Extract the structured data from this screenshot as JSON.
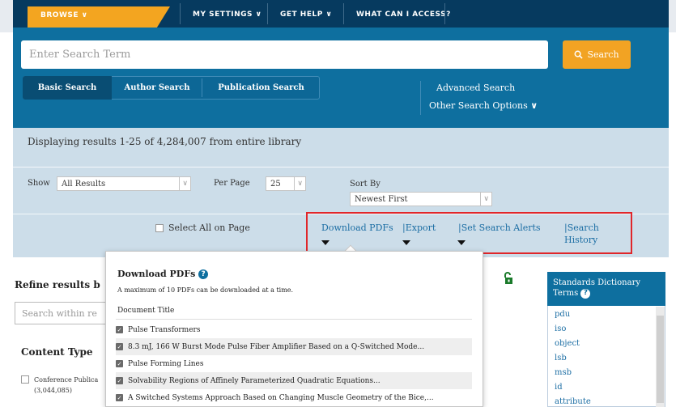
{
  "nav": {
    "browse": "BROWSE",
    "my_settings": "MY SETTINGS",
    "get_help": "GET HELP",
    "what_access": "WHAT CAN I ACCESS?"
  },
  "search": {
    "placeholder": "Enter Search Term",
    "button": "Search",
    "tabs": [
      "Basic Search",
      "Author Search",
      "Publication Search"
    ],
    "advanced": "Advanced Search",
    "other_options": "Other Search Options"
  },
  "results": {
    "count_text": "Displaying results 1-25 of 4,284,007 from entire library",
    "show_label": "Show",
    "show_value": "All Results",
    "per_page_label": "Per Page",
    "per_page_value": "25",
    "sort_label": "Sort By",
    "sort_value": "Newest First",
    "select_all": "Select All on Page",
    "actions": {
      "download": "Download PDFs",
      "export": "|Export",
      "alerts": "|Set Search Alerts",
      "history_line1": "|Search",
      "history_line2": "History"
    }
  },
  "refine": {
    "title": "Refine results b",
    "placeholder": "Search within re",
    "content_type": "Content Type",
    "item_label": "Conference Publica",
    "item_count": "(3,044,085)"
  },
  "popover": {
    "title": "Download PDFs",
    "note": "A maximum of 10 PDFs can be downloaded at a time.",
    "column": "Document Title",
    "items": [
      "Pulse Transformers",
      "8.3 mJ, 166 W Burst Mode Pulse Fiber Amplifier Based on a Q-Switched Mode...",
      "Pulse Forming Lines",
      "Solvability Regions of Affinely Parameterized Quadratic Equations...",
      "A Switched Systems Approach Based on Changing Muscle Geometry of the Bice,..."
    ]
  },
  "dictionary": {
    "title_line1": "Standards Dictionary",
    "title_line2": "Terms",
    "terms": [
      "pdu",
      "iso",
      "object",
      "lsb",
      "msb",
      "id",
      "attribute"
    ]
  },
  "colors": {
    "nav_dark": "#063a5f",
    "accent_orange": "#f3a520",
    "search_band": "#0e6f9f",
    "results_band": "#ccdde9",
    "highlight_box": "#e0262a",
    "link": "#1c6ea4"
  }
}
